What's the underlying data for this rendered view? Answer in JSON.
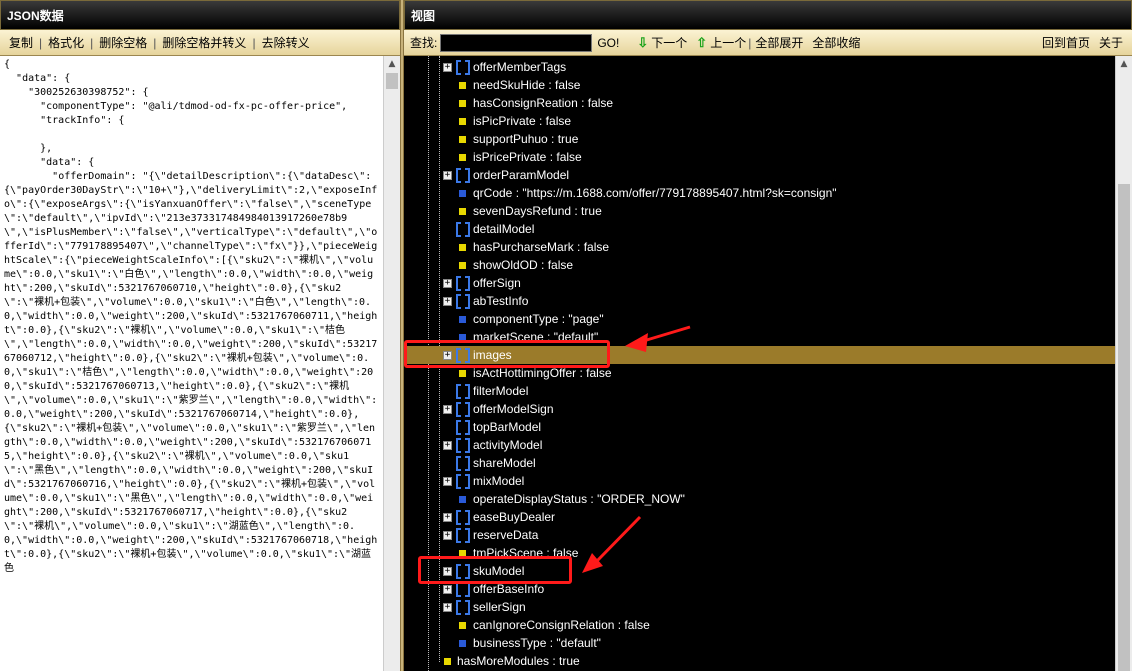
{
  "left_panel": {
    "title": "JSON数据",
    "toolbar": [
      "复制",
      "格式化",
      "删除空格",
      "删除空格并转义",
      "去除转义"
    ],
    "json_text": "{\n  \"data\": {\n    \"300252630398752\": {\n      \"componentType\": \"@ali/tdmod-od-fx-pc-offer-price\",\n      \"trackInfo\": {\n\n      },\n      \"data\": {\n        \"offerDomain\": \"{\\\"detailDescription\\\":{\\\"dataDesc\\\":{\\\"payOrder30DayStr\\\":\\\"10+\\\"},\\\"deliveryLimit\\\":2,\\\"exposeInfo\\\":{\\\"exposeArgs\\\":{\\\"isYanxuanOffer\\\":\\\"false\\\",\\\"sceneType\\\":\\\"default\\\",\\\"ipvId\\\":\\\"213e3733174849840139172​60e78b9\\\",\\\"isPlusMember\\\":\\\"false\\\",\\\"verticalType\\\":\\\"default\\\",\\\"offerId\\\":\\\"779178895407\\\",\\\"channelType\\\":\\\"fx\\\"}},\\\"pieceWeightScale\\\":{\\\"pieceWeightScaleInfo\\\":[{\\\"sku2\\\":\\\"裸机\\\",\\\"volume\\\":0.0,\\\"sku1\\\":\\\"白色\\\",\\\"length\\\":0.0,\\\"width\\\":0.0,\\\"weight\\\":200,\\\"skuId\\\":5321767060710,\\\"height\\\":0.0},{\\\"sku2\\\":\\\"裸机+包装\\\",\\\"volume\\\":0.0,\\\"sku1\\\":\\\"白色\\\",\\\"length\\\":0.0,\\\"width\\\":0.0,\\\"weight\\\":200,\\\"skuId\\\":5321767060711,\\\"height\\\":0.0},{\\\"sku2\\\":\\\"裸机\\\",\\\"volume\\\":0.0,\\\"sku1\\\":\\\"桔色\\\",\\\"length\\\":0.0,\\\"width\\\":0.0,\\\"weight\\\":200,\\\"skuId\\\":5321767060712,\\\"height\\\":0.0},{\\\"sku2\\\":\\\"裸机+包装\\\",\\\"volume\\\":0.0,\\\"sku1\\\":\\\"桔色\\\",\\\"length\\\":0.0,\\\"width\\\":0.0,\\\"weight\\\":200,\\\"skuId\\\":5321767060713,\\\"height\\\":0.0},{\\\"sku2\\\":\\\"裸机\\\",\\\"volume\\\":0.0,\\\"sku1\\\":\\\"紫罗兰\\\",\\\"length\\\":0.0,\\\"width\\\":0.0,\\\"weight\\\":200,\\\"skuId\\\":5321767060714,\\\"height\\\":0.0},{\\\"sku2\\\":\\\"裸机+包装\\\",\\\"volume\\\":0.0,\\\"sku1\\\":\\\"紫罗兰\\\",\\\"length\\\":0.0,\\\"width\\\":0.0,\\\"weight\\\":200,\\\"skuId\\\":5321767060715,\\\"height\\\":0.0},{\\\"sku2\\\":\\\"裸机\\\",\\\"volume\\\":0.0,\\\"sku1\\\":\\\"黑色\\\",\\\"length\\\":0.0,\\\"width\\\":0.0,\\\"weight\\\":200,\\\"skuId\\\":5321767060716,\\\"height\\\":0.0},{\\\"sku2\\\":\\\"裸机+包装\\\",\\\"volume\\\":0.0,\\\"sku1\\\":\\\"黑色\\\",\\\"length\\\":0.0,\\\"width\\\":0.0,\\\"weight\\\":200,\\\"skuId\\\":5321767060717,\\\"height\\\":0.0},{\\\"sku2\\\":\\\"裸机\\\",\\\"volume\\\":0.0,\\\"sku1\\\":\\\"湖蓝色\\\",\\\"length\\\":0.0,\\\"width\\\":0.0,\\\"weight\\\":200,\\\"skuId\\\":5321767060718,\\\"height\\\":0.0},{\\\"sku2\\\":\\\"裸机+包装\\\",\\\"volume\\\":0.0,\\\"sku1\\\":\\\"湖蓝色"
  },
  "right_panel": {
    "title": "视图",
    "search_label": "查找:",
    "search_value": "",
    "go": "GO!",
    "next": "下一个",
    "prev": "上一个",
    "expand_all": "全部展开",
    "collapse_all": "全部收缩",
    "home": "回到首页",
    "about": "关于"
  },
  "tree_rows": [
    {
      "kind": "object",
      "text": "offerMemberTags",
      "expander": "+"
    },
    {
      "kind": "value",
      "text": "needSkuHide : false",
      "color": "#e8d800"
    },
    {
      "kind": "value",
      "text": "hasConsignReation : false",
      "color": "#e8d800"
    },
    {
      "kind": "value",
      "text": "isPicPrivate : false",
      "color": "#e8d800"
    },
    {
      "kind": "value",
      "text": "supportPuhuo : true",
      "color": "#e8d800"
    },
    {
      "kind": "value",
      "text": "isPricePrivate : false",
      "color": "#e8d800"
    },
    {
      "kind": "object",
      "text": "orderParamModel",
      "expander": "+"
    },
    {
      "kind": "value",
      "text": "qrCode : \"https://m.1688.com/offer/779178895407.html?sk=consign\"",
      "color": "#2a5ad8"
    },
    {
      "kind": "value",
      "text": "sevenDaysRefund : true",
      "color": "#e8d800"
    },
    {
      "kind": "object",
      "text": "detailModel",
      "expander": ""
    },
    {
      "kind": "value",
      "text": "hasPurcharseMark : false",
      "color": "#e8d800"
    },
    {
      "kind": "value",
      "text": "showOldOD : false",
      "color": "#e8d800"
    },
    {
      "kind": "object",
      "text": "offerSign",
      "expander": "+"
    },
    {
      "kind": "object",
      "text": "abTestInfo",
      "expander": "+"
    },
    {
      "kind": "value",
      "text": "componentType : \"page\"",
      "color": "#2a5ad8"
    },
    {
      "kind": "value",
      "text": "marketScene : \"default\"",
      "color": "#2a5ad8"
    },
    {
      "kind": "object",
      "text": "images",
      "expander": "+",
      "selected": true
    },
    {
      "kind": "value",
      "text": "isActHottimingOffer : false",
      "color": "#e8d800"
    },
    {
      "kind": "object",
      "text": "filterModel",
      "expander": ""
    },
    {
      "kind": "object",
      "text": "offerModelSign",
      "expander": "+"
    },
    {
      "kind": "object",
      "text": "topBarModel",
      "expander": ""
    },
    {
      "kind": "object",
      "text": "activityModel",
      "expander": "+"
    },
    {
      "kind": "object",
      "text": "shareModel",
      "expander": ""
    },
    {
      "kind": "object",
      "text": "mixModel",
      "expander": "+"
    },
    {
      "kind": "value",
      "text": "operateDisplayStatus : \"ORDER_NOW\"",
      "color": "#2a5ad8"
    },
    {
      "kind": "object",
      "text": "easeBuyDealer",
      "expander": "+"
    },
    {
      "kind": "object",
      "text": "reserveData",
      "expander": "+"
    },
    {
      "kind": "value",
      "text": "tmPickScene : false",
      "color": "#e8d800"
    },
    {
      "kind": "object",
      "text": "skuModel",
      "expander": "+"
    },
    {
      "kind": "object",
      "text": "offerBaseInfo",
      "expander": "+"
    },
    {
      "kind": "object",
      "text": "sellerSign",
      "expander": "+"
    },
    {
      "kind": "value",
      "text": "canIgnoreConsignRelation : false",
      "color": "#e8d800"
    },
    {
      "kind": "value",
      "text": "businessType : \"default\"",
      "color": "#2a5ad8"
    },
    {
      "kind": "value",
      "text": "hasMoreModules : true",
      "color": "#e8d800",
      "level": 0
    }
  ],
  "colors": {
    "accent_red": "#ff1a1a",
    "selection": "#9b7b2a",
    "object_icon": "#3b79e8"
  }
}
